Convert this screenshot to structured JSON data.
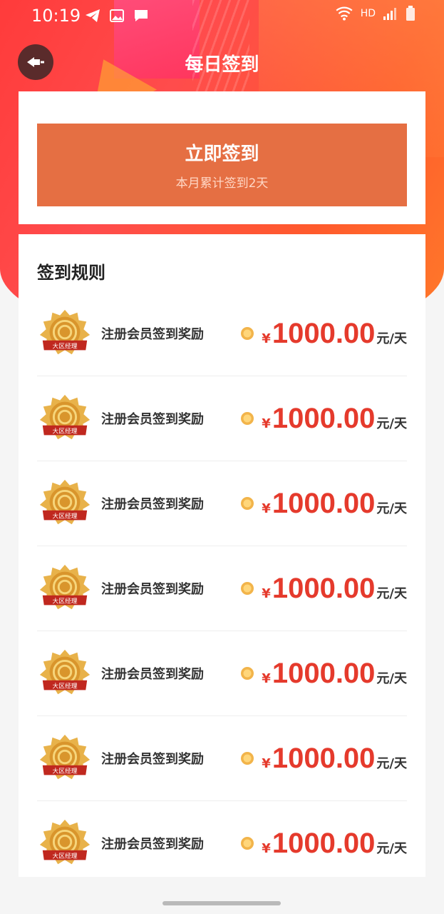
{
  "status_bar": {
    "time": "10:19",
    "left_icons": [
      "telegram-icon",
      "image-icon",
      "message-icon"
    ],
    "right_icons": [
      "wifi-icon",
      "signal-icon",
      "battery-icon"
    ],
    "hd_label": "HD"
  },
  "header": {
    "back_icon": "back-icon",
    "title": "每日签到"
  },
  "signin": {
    "button_label": "立即签到",
    "subtitle": "本月累计签到2天"
  },
  "rules": {
    "title": "签到规则",
    "items": [
      {
        "badge_label": "大区经理",
        "name": "注册会员签到奖励",
        "currency": "¥",
        "amount": "1000.00",
        "unit": "元/天"
      },
      {
        "badge_label": "大区经理",
        "name": "注册会员签到奖励",
        "currency": "¥",
        "amount": "1000.00",
        "unit": "元/天"
      },
      {
        "badge_label": "大区经理",
        "name": "注册会员签到奖励",
        "currency": "¥",
        "amount": "1000.00",
        "unit": "元/天"
      },
      {
        "badge_label": "大区经理",
        "name": "注册会员签到奖励",
        "currency": "¥",
        "amount": "1000.00",
        "unit": "元/天"
      },
      {
        "badge_label": "大区经理",
        "name": "注册会员签到奖励",
        "currency": "¥",
        "amount": "1000.00",
        "unit": "元/天"
      },
      {
        "badge_label": "大区经理",
        "name": "注册会员签到奖励",
        "currency": "¥",
        "amount": "1000.00",
        "unit": "元/天"
      },
      {
        "badge_label": "大区经理",
        "name": "注册会员签到奖励",
        "currency": "¥",
        "amount": "1000.00",
        "unit": "元/天"
      }
    ]
  },
  "colors": {
    "accent": "#e56f43",
    "price": "#e53a2c",
    "hero_start": "#ff3b3b",
    "hero_end": "#ff7a2a"
  }
}
